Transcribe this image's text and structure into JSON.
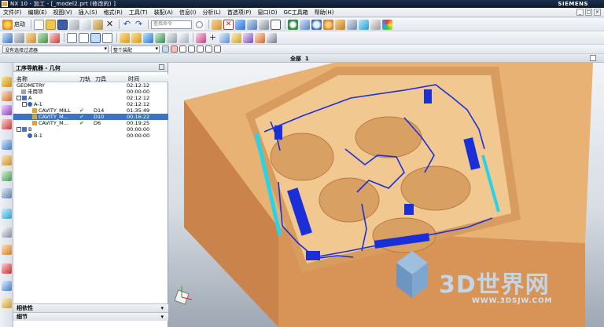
{
  "window": {
    "title": "NX 10 - 加工 - [_model2.prt  (修改的) ]",
    "brand": "SIEMENS",
    "controls": [
      "_",
      "□",
      "×"
    ]
  },
  "menu": [
    "文件(F)",
    "编辑(E)",
    "视图(V)",
    "插入(S)",
    "格式(R)",
    "工具(T)",
    "装配(A)",
    "信息(I)",
    "分析(L)",
    "首选项(P)",
    "窗口(O)",
    "GC工具箱",
    "帮助(H)"
  ],
  "toolbar": {
    "start_label": "启动",
    "command_search_placeholder": "查找命令",
    "selection_filter": "没有选择过滤器",
    "assembly_scope": "整个装配"
  },
  "graphics_tab": {
    "label": "全部",
    "index": "1"
  },
  "navigator": {
    "title": "工序导航器 - 几何",
    "columns": {
      "name": "名称",
      "toolpath": "刀轨",
      "tool": "刀具",
      "time": "时间"
    },
    "rows": [
      {
        "name": "GEOMETRY",
        "check": "",
        "tool": "",
        "time": "02:12:12",
        "level": 0,
        "selected": false
      },
      {
        "name": "未用项",
        "check": "",
        "tool": "",
        "time": "00:00:00",
        "level": 1,
        "selected": false
      },
      {
        "name": "A",
        "check": "",
        "tool": "",
        "time": "02:12:12",
        "level": 1,
        "selected": false
      },
      {
        "name": "A-1",
        "check": "",
        "tool": "",
        "time": "02:12:12",
        "level": 2,
        "selected": false
      },
      {
        "name": "CAVITY_MILL",
        "check": "✔",
        "tool": "D14",
        "time": "01:35:49",
        "level": 3,
        "selected": false
      },
      {
        "name": "CAVITY_M...",
        "check": "✔",
        "tool": "D10",
        "time": "00:16:22",
        "level": 3,
        "selected": true
      },
      {
        "name": "CAVITY_M...",
        "check": "✔",
        "tool": "D6",
        "time": "00:19:25",
        "level": 3,
        "selected": false
      },
      {
        "name": "B",
        "check": "",
        "tool": "",
        "time": "00:00:00",
        "level": 1,
        "selected": false
      },
      {
        "name": "B-1",
        "check": "",
        "tool": "",
        "time": "00:00:00",
        "level": 2,
        "selected": false
      }
    ],
    "footer": [
      "相依性",
      "细节"
    ]
  },
  "watermark": {
    "text": "3D世界网",
    "url": "WWW.3DSJW.COM"
  },
  "colors": {
    "part": "#e8b072",
    "toolpath": "#1a2fd8",
    "selection": "#3d73c5",
    "accent_cyan": "#27d3e8"
  }
}
